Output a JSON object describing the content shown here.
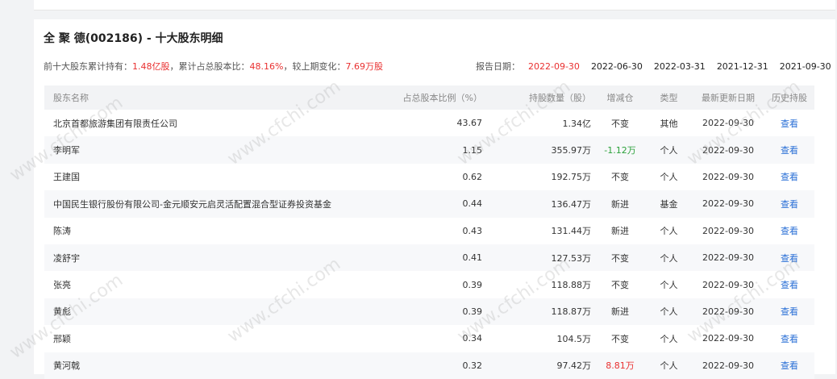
{
  "title": "全 聚 德(002186) - 十大股东明细",
  "summary": {
    "prefix": "前十大股东累计持有：",
    "total_shares": "1.48亿股",
    "ratio_label": "，累计占总股本比：",
    "ratio": "48.16%",
    "change_label": "，较上期变化：",
    "change": "7.69万股"
  },
  "report_dates": {
    "label": "报告日期：",
    "dates": [
      "2022-09-30",
      "2022-06-30",
      "2022-03-31",
      "2021-12-31",
      "2021-09-30"
    ]
  },
  "table": {
    "headers": [
      "股东名称",
      "占总股本比例（%）",
      "持股数量（股）",
      "增减仓",
      "类型",
      "最新更新日期",
      "历史持股"
    ],
    "rows": [
      {
        "name": "北京首都旅游集团有限责任公司",
        "pct": "43.67",
        "qty": "1.34亿",
        "change": "不变",
        "type": "其他",
        "date": "2022-09-30",
        "hist": "查看"
      },
      {
        "name": "李明军",
        "pct": "1.15",
        "qty": "355.97万",
        "change": "-1.12万",
        "type": "个人",
        "date": "2022-09-30",
        "hist": "查看"
      },
      {
        "name": "王建国",
        "pct": "0.62",
        "qty": "192.75万",
        "change": "不变",
        "type": "个人",
        "date": "2022-09-30",
        "hist": "查看"
      },
      {
        "name": "中国民生银行股份有限公司-金元顺安元启灵活配置混合型证券投资基金",
        "pct": "0.44",
        "qty": "136.47万",
        "change": "新进",
        "type": "基金",
        "date": "2022-09-30",
        "hist": "查看"
      },
      {
        "name": "陈涛",
        "pct": "0.43",
        "qty": "131.44万",
        "change": "新进",
        "type": "个人",
        "date": "2022-09-30",
        "hist": "查看"
      },
      {
        "name": "凌舒宇",
        "pct": "0.41",
        "qty": "127.53万",
        "change": "不变",
        "type": "个人",
        "date": "2022-09-30",
        "hist": "查看"
      },
      {
        "name": "张亮",
        "pct": "0.39",
        "qty": "118.88万",
        "change": "不变",
        "type": "个人",
        "date": "2022-09-30",
        "hist": "查看"
      },
      {
        "name": "黄彪",
        "pct": "0.39",
        "qty": "118.87万",
        "change": "新进",
        "type": "个人",
        "date": "2022-09-30",
        "hist": "查看"
      },
      {
        "name": "邢颖",
        "pct": "0.34",
        "qty": "104.5万",
        "change": "不变",
        "type": "个人",
        "date": "2022-09-30",
        "hist": "查看"
      },
      {
        "name": "黄河戟",
        "pct": "0.32",
        "qty": "97.42万",
        "change": "8.81万",
        "type": "个人",
        "date": "2022-09-30",
        "hist": "查看"
      }
    ]
  },
  "watermark": "www.cfchi.com",
  "colors": {
    "accent_red": "#e93030",
    "green": "#2ba13a",
    "link_blue": "#2a6fd6"
  }
}
